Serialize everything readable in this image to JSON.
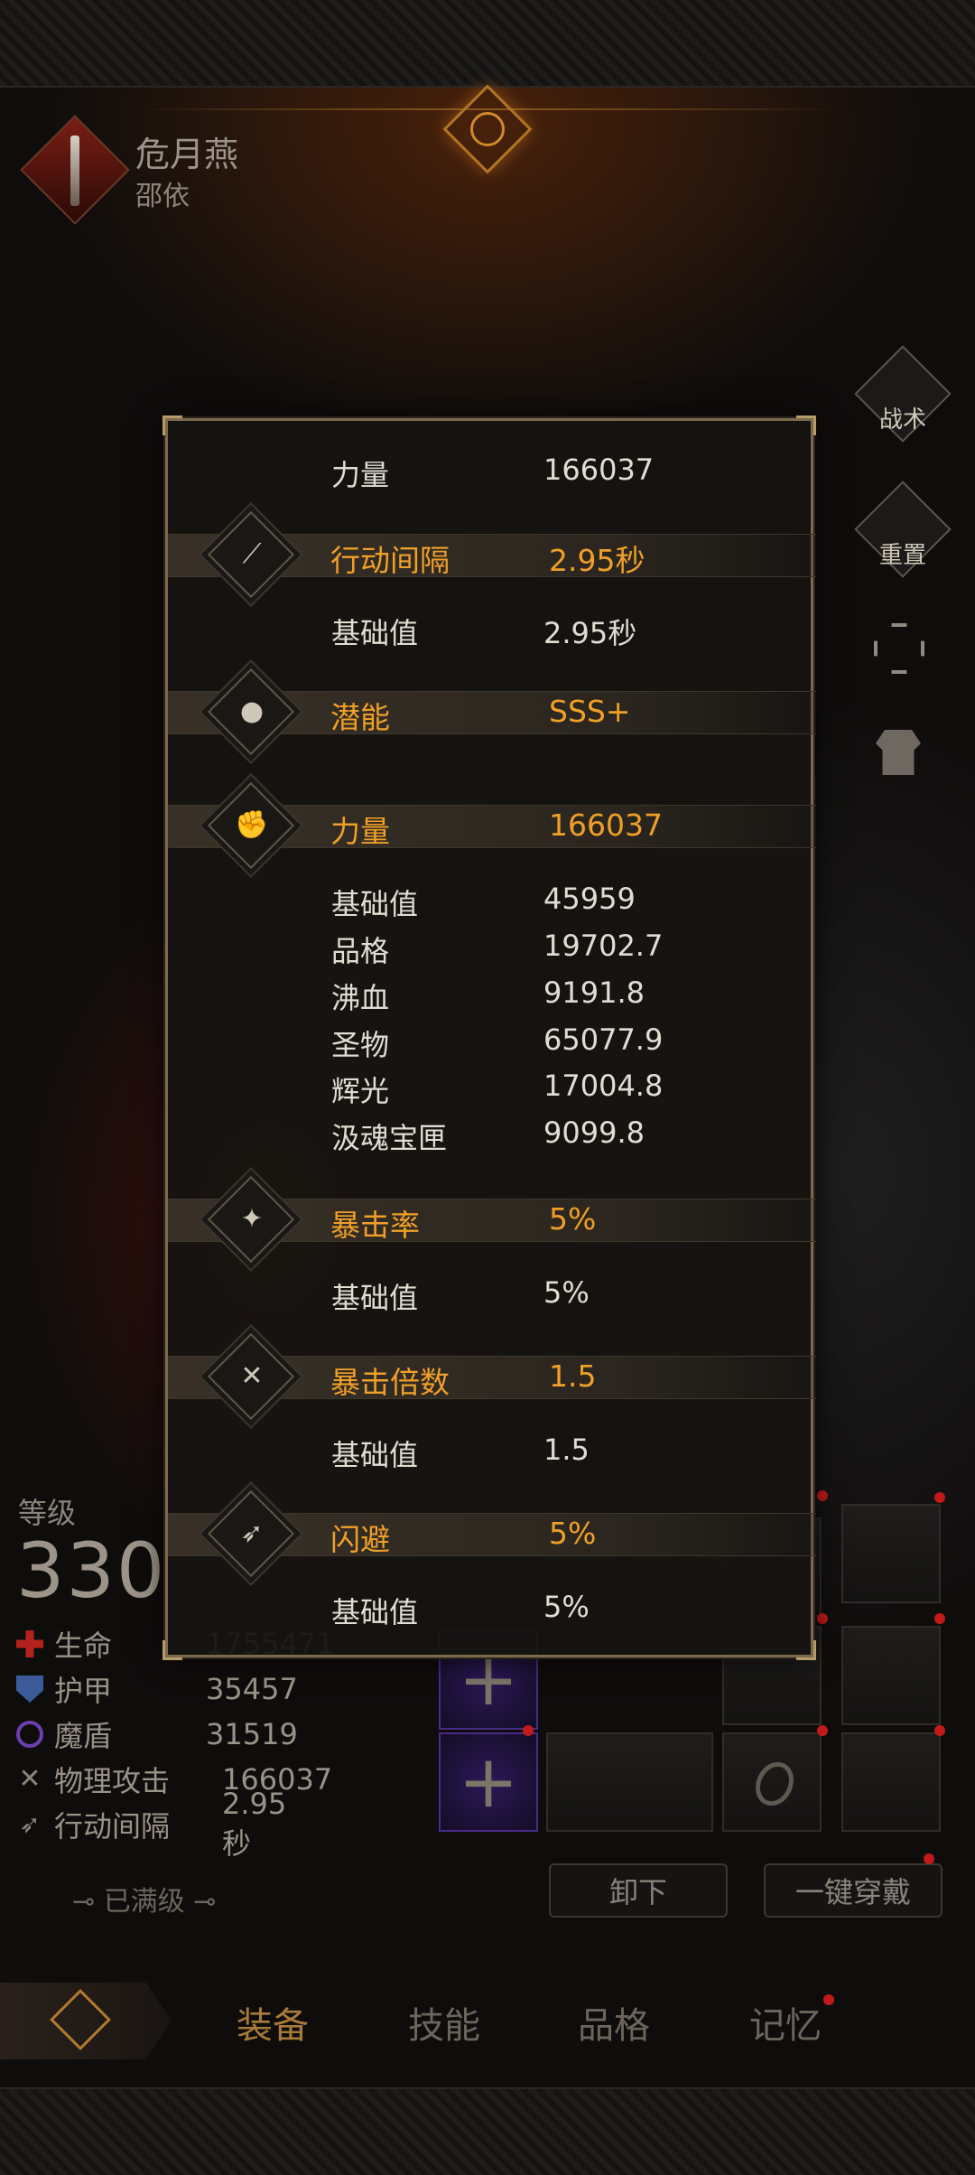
{
  "hero": {
    "name": "危月燕",
    "subtitle": "邵依"
  },
  "side_buttons": {
    "tactics": "战术",
    "reset": "重置"
  },
  "left_stats": {
    "level_label": "等级",
    "level_value": "330",
    "rows": [
      {
        "label": "生命",
        "value": "1755471",
        "icon": "red-cross-icon"
      },
      {
        "label": "护甲",
        "value": "35457",
        "icon": "shield-icon"
      },
      {
        "label": "魔盾",
        "value": "31519",
        "icon": "swirl-icon"
      },
      {
        "label": "物理攻击",
        "value": "166037",
        "icon": "crossed-swords-icon"
      },
      {
        "label": "行动间隔",
        "value": "2.95秒",
        "icon": "wing-icon"
      }
    ],
    "maxed_label": "已满级"
  },
  "actions": {
    "unequip": "卸下",
    "equip_all": "一键穿戴"
  },
  "tabs": [
    {
      "label": "装备",
      "active": true
    },
    {
      "label": "技能",
      "active": false
    },
    {
      "label": "品格",
      "active": false
    },
    {
      "label": "记忆",
      "active": false,
      "badge": true
    }
  ],
  "panel": {
    "top_line": {
      "name": "力量",
      "value": "166037"
    },
    "sections": [
      {
        "icon": "slash-icon",
        "name": "行动间隔",
        "value": "2.95秒",
        "lines": [
          {
            "name": "基础值",
            "value": "2.95秒"
          }
        ]
      },
      {
        "icon": "bust-icon",
        "name": "潜能",
        "value": "SSS+",
        "lines": []
      },
      {
        "icon": "fist-icon",
        "name": "力量",
        "value": "166037",
        "lines": [
          {
            "name": "基础值",
            "value": "45959"
          },
          {
            "name": "品格",
            "value": "19702.7"
          },
          {
            "name": "沸血",
            "value": "9191.8"
          },
          {
            "name": "圣物",
            "value": "65077.9"
          },
          {
            "name": "辉光",
            "value": "17004.8"
          },
          {
            "name": "汲魂宝匣",
            "value": "9099.8"
          }
        ]
      },
      {
        "icon": "crit-hand-icon",
        "name": "暴击率",
        "value": "5%",
        "lines": [
          {
            "name": "基础值",
            "value": "5%"
          }
        ]
      },
      {
        "icon": "crossed-blades-icon",
        "name": "暴击倍数",
        "value": "1.5",
        "lines": [
          {
            "name": "基础值",
            "value": "1.5"
          }
        ]
      },
      {
        "icon": "boot-icon",
        "name": "闪避",
        "value": "5%",
        "lines": [
          {
            "name": "基础值",
            "value": "5%"
          }
        ]
      }
    ]
  },
  "colors": {
    "accent": "#f0a028",
    "text": "#e2ddd2",
    "panel_border": "#7c6a4c"
  }
}
